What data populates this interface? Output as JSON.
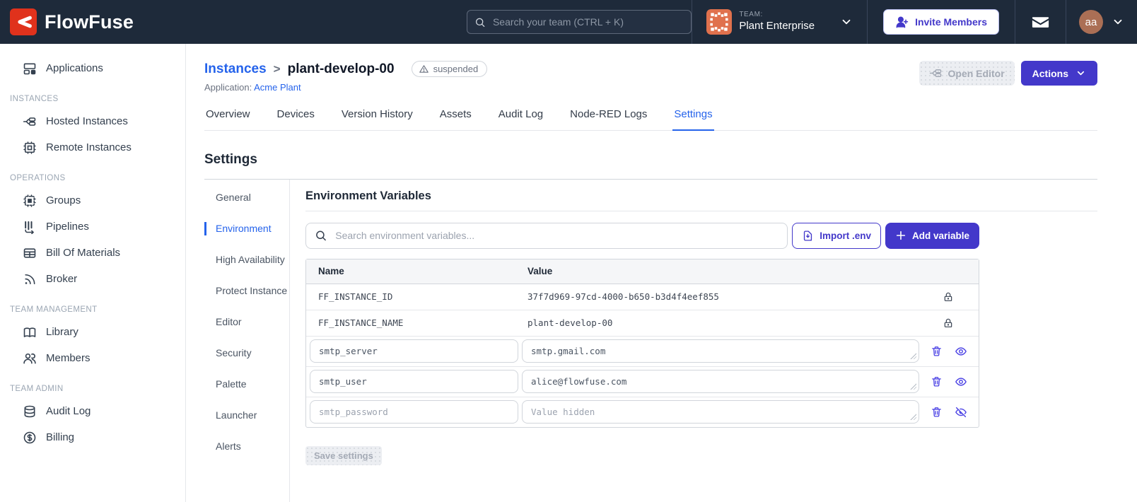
{
  "colors": {
    "navbar_bg": "#1e2a3a",
    "brand_red": "#e0321c",
    "accent_indigo": "#4338ca",
    "link_blue": "#2563eb",
    "team_avatar_orange": "#e0714d",
    "user_avatar_brown": "#ab6f55"
  },
  "icons": {
    "search": "magnifier",
    "chevron-down": "v-chevron",
    "mail": "envelope",
    "invite": "user-plus",
    "warning": "triangle-exclamation",
    "lock": "padlock",
    "trash": "trash-can",
    "eye": "eye-open",
    "eye-off": "eye-slashed",
    "import": "document-down-arrow",
    "plus": "plus-sign"
  },
  "navbar": {
    "brand": "FlowFuse",
    "search_placeholder": "Search your team (CTRL + K)",
    "team_label": "TEAM:",
    "team_name": "Plant Enterprise",
    "invite_label": "Invite Members",
    "avatar_initials": "aa"
  },
  "sidebar": {
    "applications": "Applications",
    "sections": [
      {
        "header": "INSTANCES",
        "items": [
          "Hosted Instances",
          "Remote Instances"
        ]
      },
      {
        "header": "OPERATIONS",
        "items": [
          "Groups",
          "Pipelines",
          "Bill Of Materials",
          "Broker"
        ]
      },
      {
        "header": "TEAM MANAGEMENT",
        "items": [
          "Library",
          "Members"
        ]
      },
      {
        "header": "TEAM ADMIN",
        "items": [
          "Audit Log",
          "Billing"
        ]
      }
    ]
  },
  "header": {
    "breadcrumb_parent": "Instances",
    "breadcrumb_separator": ">",
    "instance_name": "plant-develop-00",
    "status_badge": "suspended",
    "application_label": "Application:",
    "application_name": "Acme Plant",
    "open_editor_label": "Open Editor",
    "actions_label": "Actions"
  },
  "tabs": [
    "Overview",
    "Devices",
    "Version History",
    "Assets",
    "Audit Log",
    "Node-RED Logs",
    "Settings"
  ],
  "settings": {
    "title": "Settings",
    "nav": [
      "General",
      "Environment",
      "High Availability",
      "Protect Instance",
      "Editor",
      "Security",
      "Palette",
      "Launcher",
      "Alerts"
    ],
    "active_nav": "Environment"
  },
  "env": {
    "title": "Environment Variables",
    "search_placeholder": "Search environment variables...",
    "import_label": "Import .env",
    "add_label": "Add variable",
    "columns": [
      "Name",
      "Value"
    ],
    "locked_rows": [
      {
        "name": "FF_INSTANCE_ID",
        "value": "37f7d969-97cd-4000-b650-b3d4f4eef855"
      },
      {
        "name": "FF_INSTANCE_NAME",
        "value": "plant-develop-00"
      }
    ],
    "editable_rows": [
      {
        "name": "smtp_server",
        "value": "smtp.gmail.com",
        "hidden": false
      },
      {
        "name": "smtp_user",
        "value": "alice@flowfuse.com",
        "hidden": false
      },
      {
        "name": "smtp_password",
        "value": "",
        "value_placeholder": "Value hidden",
        "hidden": true
      }
    ],
    "save_label": "Save settings"
  }
}
